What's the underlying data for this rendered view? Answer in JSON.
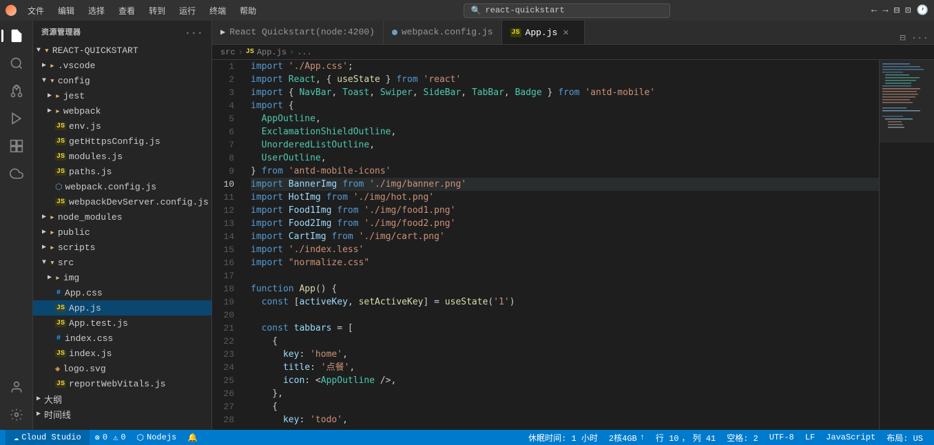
{
  "titlebar": {
    "logo": "cloud-studio-logo",
    "menus": [
      "文件",
      "编辑",
      "选择",
      "查看",
      "转到",
      "运行",
      "终端",
      "帮助"
    ],
    "search_placeholder": "react-quickstart",
    "nav_back": "←",
    "nav_forward": "→"
  },
  "sidebar": {
    "title": "资源管理器",
    "more_actions": "...",
    "tree": [
      {
        "id": "root",
        "label": "REACT-QUICKSTART",
        "indent": 0,
        "type": "root-folder",
        "expanded": true,
        "arrow": "▼"
      },
      {
        "id": "vscode",
        "label": ".vscode",
        "indent": 1,
        "type": "folder",
        "expanded": false,
        "arrow": "▶"
      },
      {
        "id": "config",
        "label": "config",
        "indent": 1,
        "type": "folder",
        "expanded": true,
        "arrow": "▼"
      },
      {
        "id": "jest",
        "label": "jest",
        "indent": 2,
        "type": "folder",
        "expanded": false,
        "arrow": "▶"
      },
      {
        "id": "webpack",
        "label": "webpack",
        "indent": 2,
        "type": "folder",
        "expanded": false,
        "arrow": "▶"
      },
      {
        "id": "env.js",
        "label": "env.js",
        "indent": 2,
        "type": "js",
        "expanded": false,
        "arrow": ""
      },
      {
        "id": "getHttpsConfig.js",
        "label": "getHttpsConfig.js",
        "indent": 2,
        "type": "js",
        "expanded": false,
        "arrow": ""
      },
      {
        "id": "modules.js",
        "label": "modules.js",
        "indent": 2,
        "type": "js",
        "expanded": false,
        "arrow": ""
      },
      {
        "id": "paths.js",
        "label": "paths.js",
        "indent": 2,
        "type": "js",
        "expanded": false,
        "arrow": ""
      },
      {
        "id": "webpack.config.js",
        "label": "webpack.config.js",
        "indent": 2,
        "type": "webpack",
        "expanded": false,
        "arrow": ""
      },
      {
        "id": "webpackDevServer.config.js",
        "label": "webpackDevServer.config.js",
        "indent": 2,
        "type": "js",
        "expanded": false,
        "arrow": ""
      },
      {
        "id": "node_modules",
        "label": "node_modules",
        "indent": 1,
        "type": "folder",
        "expanded": false,
        "arrow": "▶"
      },
      {
        "id": "public",
        "label": "public",
        "indent": 1,
        "type": "folder",
        "expanded": false,
        "arrow": "▶"
      },
      {
        "id": "scripts",
        "label": "scripts",
        "indent": 1,
        "type": "folder",
        "expanded": false,
        "arrow": "▶"
      },
      {
        "id": "src",
        "label": "src",
        "indent": 1,
        "type": "folder",
        "expanded": true,
        "arrow": "▼"
      },
      {
        "id": "img",
        "label": "img",
        "indent": 2,
        "type": "folder",
        "expanded": false,
        "arrow": "▶"
      },
      {
        "id": "App.css",
        "label": "App.css",
        "indent": 2,
        "type": "css",
        "expanded": false,
        "arrow": ""
      },
      {
        "id": "App.js",
        "label": "App.js",
        "indent": 2,
        "type": "js",
        "expanded": false,
        "arrow": "",
        "selected": true
      },
      {
        "id": "App.test.js",
        "label": "App.test.js",
        "indent": 2,
        "type": "js",
        "expanded": false,
        "arrow": ""
      },
      {
        "id": "index.css",
        "label": "index.css",
        "indent": 2,
        "type": "css",
        "expanded": false,
        "arrow": ""
      },
      {
        "id": "index.js",
        "label": "index.js",
        "indent": 2,
        "type": "js",
        "expanded": false,
        "arrow": ""
      },
      {
        "id": "logo.svg",
        "label": "logo.svg",
        "indent": 2,
        "type": "svg",
        "expanded": false,
        "arrow": ""
      },
      {
        "id": "reportWebVitals.js",
        "label": "reportWebVitals.js",
        "indent": 2,
        "type": "js",
        "expanded": false,
        "arrow": ""
      },
      {
        "id": "outline",
        "label": "大纲",
        "indent": 0,
        "type": "section",
        "expanded": false,
        "arrow": "▶"
      },
      {
        "id": "timeline",
        "label": "时间线",
        "indent": 0,
        "type": "section",
        "expanded": false,
        "arrow": "▶"
      }
    ]
  },
  "tabs": [
    {
      "id": "terminal-tab",
      "label": "React Quickstart(node:4200)",
      "icon": "terminal",
      "modified": false,
      "active": false
    },
    {
      "id": "webpack-tab",
      "label": "webpack.config.js",
      "icon": "webpack",
      "modified": false,
      "active": false
    },
    {
      "id": "appjs-tab",
      "label": "App.js",
      "icon": "js",
      "modified": false,
      "active": true,
      "closable": true
    }
  ],
  "breadcrumb": {
    "parts": [
      "src",
      "JS App.js",
      "..."
    ]
  },
  "code": {
    "lines": [
      {
        "num": 1,
        "tokens": [
          {
            "t": "kw",
            "v": "import"
          },
          {
            "t": "plain",
            "v": " "
          },
          {
            "t": "str",
            "v": "'./App.css'"
          },
          {
            "t": "plain",
            "v": ";"
          }
        ]
      },
      {
        "num": 2,
        "tokens": [
          {
            "t": "kw",
            "v": "import"
          },
          {
            "t": "plain",
            "v": " "
          },
          {
            "t": "cls",
            "v": "React"
          },
          {
            "t": "plain",
            "v": ", { "
          },
          {
            "t": "fn",
            "v": "useState"
          },
          {
            "t": "plain",
            "v": " } "
          },
          {
            "t": "kw",
            "v": "from"
          },
          {
            "t": "plain",
            "v": " "
          },
          {
            "t": "str",
            "v": "'react'"
          }
        ]
      },
      {
        "num": 3,
        "tokens": [
          {
            "t": "kw",
            "v": "import"
          },
          {
            "t": "plain",
            "v": " { "
          },
          {
            "t": "cls",
            "v": "NavBar"
          },
          {
            "t": "plain",
            "v": ", "
          },
          {
            "t": "cls",
            "v": "Toast"
          },
          {
            "t": "plain",
            "v": ", "
          },
          {
            "t": "cls",
            "v": "Swiper"
          },
          {
            "t": "plain",
            "v": ", "
          },
          {
            "t": "cls",
            "v": "SideBar"
          },
          {
            "t": "plain",
            "v": ", "
          },
          {
            "t": "cls",
            "v": "TabBar"
          },
          {
            "t": "plain",
            "v": ", "
          },
          {
            "t": "cls",
            "v": "Badge"
          },
          {
            "t": "plain",
            "v": " } "
          },
          {
            "t": "kw",
            "v": "from"
          },
          {
            "t": "plain",
            "v": " "
          },
          {
            "t": "str",
            "v": "'antd-mobile'"
          }
        ]
      },
      {
        "num": 4,
        "tokens": [
          {
            "t": "kw",
            "v": "import"
          },
          {
            "t": "plain",
            "v": " {"
          }
        ]
      },
      {
        "num": 5,
        "tokens": [
          {
            "t": "plain",
            "v": "  "
          },
          {
            "t": "cls",
            "v": "AppOutline"
          },
          {
            "t": "plain",
            "v": ","
          }
        ]
      },
      {
        "num": 6,
        "tokens": [
          {
            "t": "plain",
            "v": "  "
          },
          {
            "t": "cls",
            "v": "ExclamationShieldOutline"
          },
          {
            "t": "plain",
            "v": ","
          }
        ]
      },
      {
        "num": 7,
        "tokens": [
          {
            "t": "plain",
            "v": "  "
          },
          {
            "t": "cls",
            "v": "UnorderedListOutline"
          },
          {
            "t": "plain",
            "v": ","
          }
        ]
      },
      {
        "num": 8,
        "tokens": [
          {
            "t": "plain",
            "v": "  "
          },
          {
            "t": "cls",
            "v": "UserOutline"
          },
          {
            "t": "plain",
            "v": ","
          }
        ]
      },
      {
        "num": 9,
        "tokens": [
          {
            "t": "plain",
            "v": "} "
          },
          {
            "t": "kw",
            "v": "from"
          },
          {
            "t": "plain",
            "v": " "
          },
          {
            "t": "str",
            "v": "'antd-mobile-icons'"
          }
        ]
      },
      {
        "num": 10,
        "tokens": [
          {
            "t": "kw",
            "v": "import"
          },
          {
            "t": "plain",
            "v": " "
          },
          {
            "t": "var",
            "v": "BannerImg"
          },
          {
            "t": "plain",
            "v": " "
          },
          {
            "t": "kw",
            "v": "from"
          },
          {
            "t": "plain",
            "v": " "
          },
          {
            "t": "str",
            "v": "'./img/banner.png'"
          }
        ],
        "current": true
      },
      {
        "num": 11,
        "tokens": [
          {
            "t": "kw",
            "v": "import"
          },
          {
            "t": "plain",
            "v": " "
          },
          {
            "t": "var",
            "v": "HotImg"
          },
          {
            "t": "plain",
            "v": " "
          },
          {
            "t": "kw",
            "v": "from"
          },
          {
            "t": "plain",
            "v": " "
          },
          {
            "t": "str",
            "v": "'./img/hot.png'"
          }
        ]
      },
      {
        "num": 12,
        "tokens": [
          {
            "t": "kw",
            "v": "import"
          },
          {
            "t": "plain",
            "v": " "
          },
          {
            "t": "var",
            "v": "Food1Img"
          },
          {
            "t": "plain",
            "v": " "
          },
          {
            "t": "kw",
            "v": "from"
          },
          {
            "t": "plain",
            "v": " "
          },
          {
            "t": "str",
            "v": "'./img/food1.png'"
          }
        ]
      },
      {
        "num": 13,
        "tokens": [
          {
            "t": "kw",
            "v": "import"
          },
          {
            "t": "plain",
            "v": " "
          },
          {
            "t": "var",
            "v": "Food2Img"
          },
          {
            "t": "plain",
            "v": " "
          },
          {
            "t": "kw",
            "v": "from"
          },
          {
            "t": "plain",
            "v": " "
          },
          {
            "t": "str",
            "v": "'./img/food2.png'"
          }
        ]
      },
      {
        "num": 14,
        "tokens": [
          {
            "t": "kw",
            "v": "import"
          },
          {
            "t": "plain",
            "v": " "
          },
          {
            "t": "var",
            "v": "CartImg"
          },
          {
            "t": "plain",
            "v": " "
          },
          {
            "t": "kw",
            "v": "from"
          },
          {
            "t": "plain",
            "v": " "
          },
          {
            "t": "str",
            "v": "'./img/cart.png'"
          }
        ]
      },
      {
        "num": 15,
        "tokens": [
          {
            "t": "kw",
            "v": "import"
          },
          {
            "t": "plain",
            "v": " "
          },
          {
            "t": "str",
            "v": "'./index.less'"
          }
        ]
      },
      {
        "num": 16,
        "tokens": [
          {
            "t": "kw",
            "v": "import"
          },
          {
            "t": "plain",
            "v": " "
          },
          {
            "t": "str",
            "v": "\"normalize.css\""
          }
        ]
      },
      {
        "num": 17,
        "tokens": []
      },
      {
        "num": 18,
        "tokens": [
          {
            "t": "kw",
            "v": "function"
          },
          {
            "t": "plain",
            "v": " "
          },
          {
            "t": "fn",
            "v": "App"
          },
          {
            "t": "plain",
            "v": "() {"
          }
        ]
      },
      {
        "num": 19,
        "tokens": [
          {
            "t": "plain",
            "v": "  "
          },
          {
            "t": "kw",
            "v": "const"
          },
          {
            "t": "plain",
            "v": " ["
          },
          {
            "t": "var",
            "v": "activeKey"
          },
          {
            "t": "plain",
            "v": ", "
          },
          {
            "t": "fn",
            "v": "setActiveKey"
          },
          {
            "t": "plain",
            "v": "] = "
          },
          {
            "t": "fn",
            "v": "useState"
          },
          {
            "t": "plain",
            "v": "("
          },
          {
            "t": "str",
            "v": "'1'"
          },
          {
            "t": "plain",
            "v": ")"
          }
        ]
      },
      {
        "num": 20,
        "tokens": []
      },
      {
        "num": 21,
        "tokens": [
          {
            "t": "plain",
            "v": "  "
          },
          {
            "t": "kw",
            "v": "const"
          },
          {
            "t": "plain",
            "v": " "
          },
          {
            "t": "var",
            "v": "tabbars"
          },
          {
            "t": "plain",
            "v": " = ["
          }
        ]
      },
      {
        "num": 22,
        "tokens": [
          {
            "t": "plain",
            "v": "    {"
          }
        ]
      },
      {
        "num": 23,
        "tokens": [
          {
            "t": "plain",
            "v": "      "
          },
          {
            "t": "prop",
            "v": "key"
          },
          {
            "t": "plain",
            "v": ": "
          },
          {
            "t": "str",
            "v": "'home'"
          },
          {
            "t": "plain",
            "v": ","
          }
        ]
      },
      {
        "num": 24,
        "tokens": [
          {
            "t": "plain",
            "v": "      "
          },
          {
            "t": "prop",
            "v": "title"
          },
          {
            "t": "plain",
            "v": ": "
          },
          {
            "t": "str",
            "v": "'点餐'"
          },
          {
            "t": "plain",
            "v": ","
          }
        ]
      },
      {
        "num": 25,
        "tokens": [
          {
            "t": "plain",
            "v": "      "
          },
          {
            "t": "prop",
            "v": "icon"
          },
          {
            "t": "plain",
            "v": ": <"
          },
          {
            "t": "jsx-tag",
            "v": "AppOutline"
          },
          {
            "t": "plain",
            "v": " />,"
          }
        ]
      },
      {
        "num": 26,
        "tokens": [
          {
            "t": "plain",
            "v": "    },"
          }
        ]
      },
      {
        "num": 27,
        "tokens": [
          {
            "t": "plain",
            "v": "    {"
          }
        ]
      },
      {
        "num": 28,
        "tokens": [
          {
            "t": "plain",
            "v": "      "
          },
          {
            "t": "prop",
            "v": "key"
          },
          {
            "t": "plain",
            "v": ": "
          },
          {
            "t": "str",
            "v": "'todo'"
          },
          {
            "t": "plain",
            "v": ","
          }
        ]
      }
    ]
  },
  "statusbar": {
    "cloud_label": "☁ Cloud Studio",
    "errors": "⊗ 0",
    "warnings": "⚠ 0",
    "node_label": "⬡ Nodejs",
    "bell": "🔔",
    "idle_time": "休眠时间: 1 小时",
    "cpu": "2核4GB",
    "upload_icon": "↑",
    "row": "行 10",
    "col": "列 41",
    "spaces": "空格: 2",
    "encoding": "UTF-8",
    "lf": "LF",
    "language": "JavaScript",
    "layout": "布局: US"
  }
}
